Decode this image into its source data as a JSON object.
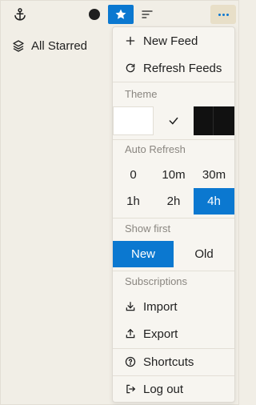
{
  "toolbar": {
    "icons": [
      "anchor-icon",
      "status-dot-icon",
      "star-icon",
      "list-icon",
      "more-icon"
    ],
    "accent_color": "#0b78d0"
  },
  "sidebar": {
    "items": [
      {
        "label": "All Starred",
        "icon": "layers-icon"
      }
    ]
  },
  "menu": {
    "new_feed": "New Feed",
    "refresh_feeds": "Refresh Feeds",
    "theme_label": "Theme",
    "theme_selected": "light",
    "auto_refresh_label": "Auto Refresh",
    "auto_refresh_options": [
      "0",
      "10m",
      "30m",
      "1h",
      "2h",
      "4h"
    ],
    "auto_refresh_selected": "4h",
    "show_first_label": "Show first",
    "show_first_options": [
      "New",
      "Old"
    ],
    "show_first_selected": "New",
    "subscriptions_label": "Subscriptions",
    "import": "Import",
    "export": "Export",
    "shortcuts": "Shortcuts",
    "log_out": "Log out"
  }
}
